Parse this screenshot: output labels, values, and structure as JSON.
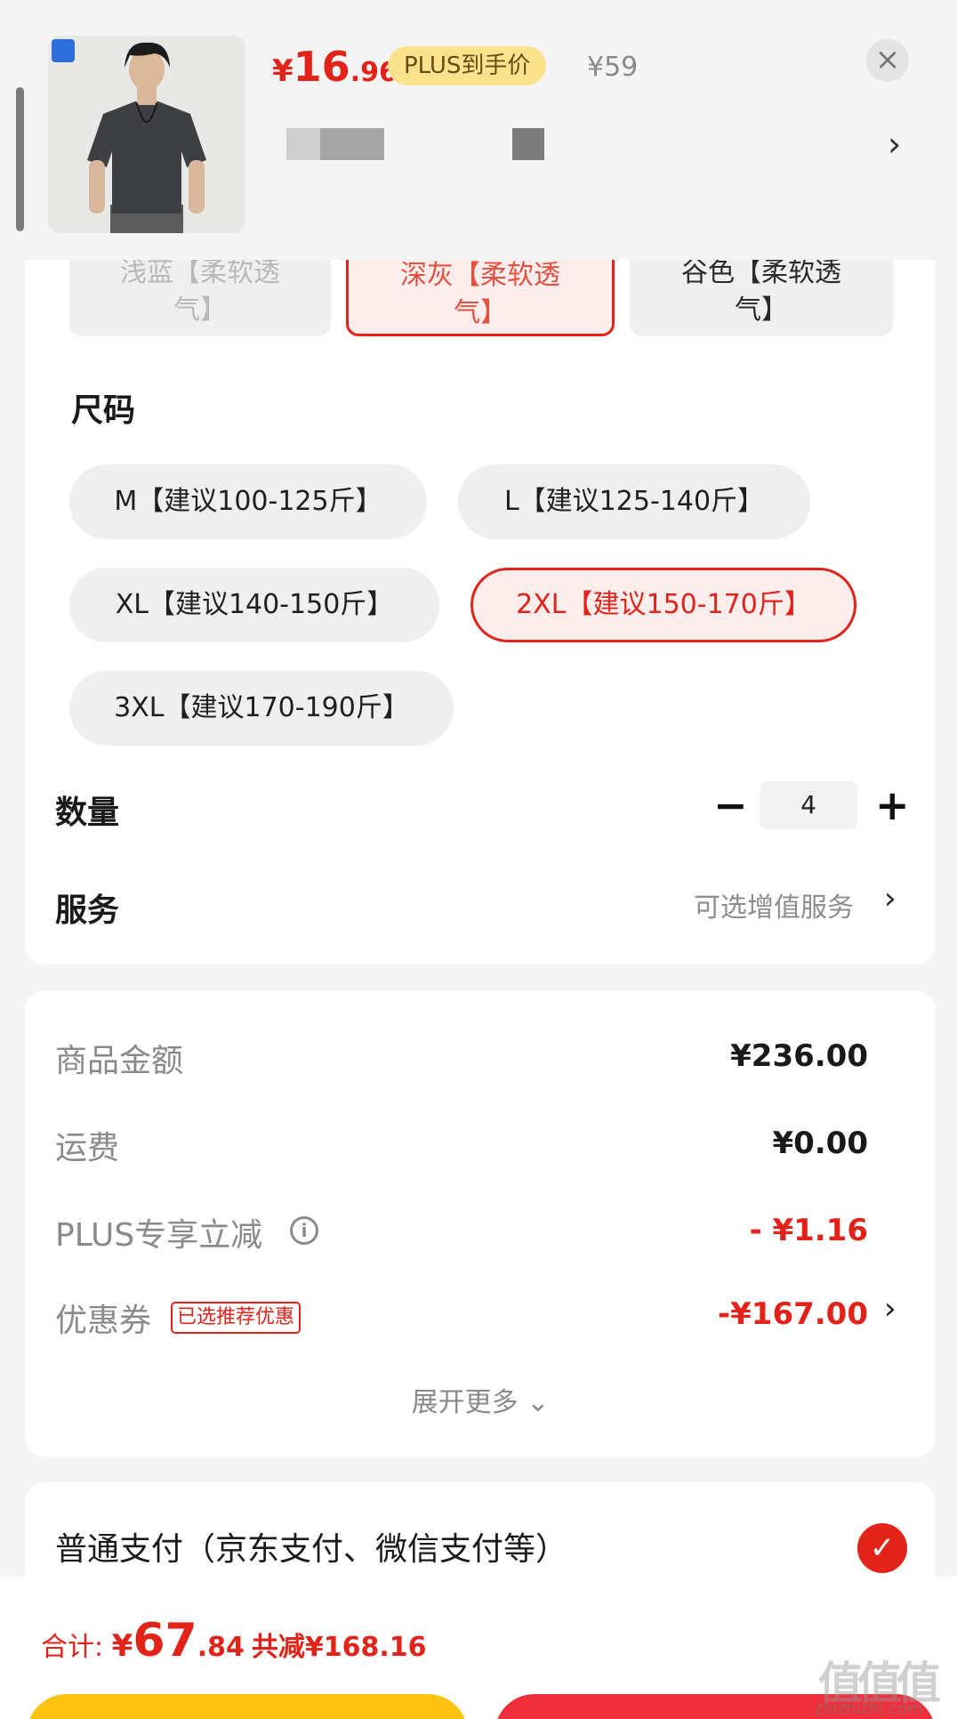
{
  "header": {
    "price_currency": "¥",
    "price_int": "16",
    "price_dec": ".96",
    "plus_tag": "PLUS到手价",
    "original_price": "¥59",
    "close": "×",
    "chevron": "›"
  },
  "colors": {
    "items": [
      {
        "line1": "浅蓝【柔软透",
        "line2": "气】"
      },
      {
        "line1": "深灰【柔软透",
        "line2": "气】"
      },
      {
        "line1": "谷色【柔软透",
        "line2": "气】"
      }
    ]
  },
  "size": {
    "label": "尺码",
    "options": [
      "M【建议100-125斤】",
      "L【建议125-140斤】",
      "XL【建议140-150斤】",
      "2XL【建议150-170斤】",
      "3XL【建议170-190斤】"
    ]
  },
  "quantity": {
    "label": "数量",
    "minus": "−",
    "value": "4",
    "plus": "+"
  },
  "service": {
    "label": "服务",
    "hint": "可选增值服务",
    "chevron": "›"
  },
  "summary": {
    "goods_label": "商品金额",
    "goods_value": "¥236.00",
    "shipping_label": "运费",
    "shipping_value": "¥0.00",
    "plus_label": "PLUS专享立减",
    "plus_info": "i",
    "plus_value": "- ¥1.16",
    "coupon_label": "优惠券",
    "coupon_tag": "已选推荐优惠",
    "coupon_value": "-¥167.00",
    "coupon_chevron": "›",
    "expand": "展开更多 ⌄"
  },
  "payment": {
    "label": "普通支付（京东支付、微信支付等）",
    "check": "✓"
  },
  "footer": {
    "total_label": "合计: ",
    "total_currency": "¥",
    "total_int": "67",
    "total_dec": ".84",
    "saved": "共减¥168.16",
    "watermark": "值值值",
    "watermark_url": "zhizhizhi.com"
  },
  "theme": {
    "accent": "#e2231a",
    "plus_gold": "#fbe28d",
    "button_yellow": "#ffc20e",
    "button_red": "#ef2f3b"
  }
}
